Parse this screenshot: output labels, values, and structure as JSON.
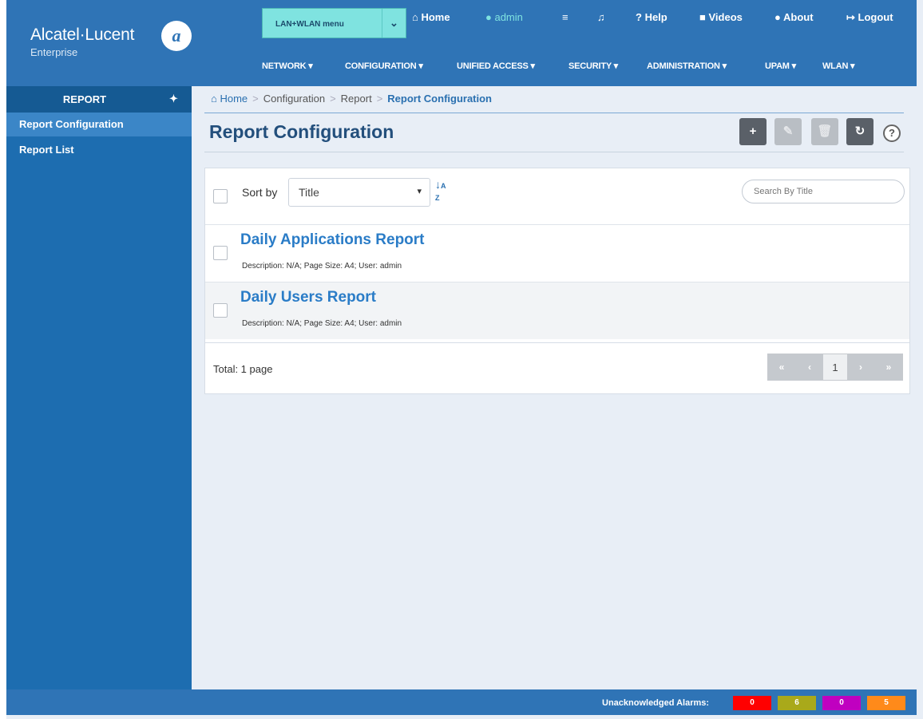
{
  "brand": {
    "name": "Alcatel·Lucent",
    "sub": "Enterprise",
    "mark": "Ð"
  },
  "header": {
    "menu_select": "LAN+WLAN menu",
    "top_links": {
      "home": "Home",
      "admin": "admin",
      "help": "Help",
      "videos": "Videos",
      "about": "About",
      "logout": "Logout"
    },
    "main_nav": [
      "NETWORK",
      "CONFIGURATION",
      "UNIFIED ACCESS",
      "SECURITY",
      "ADMINISTRATION",
      "UPAM",
      "WLAN"
    ]
  },
  "sidebar": {
    "title": "REPORT",
    "items": [
      {
        "label": "Report Configuration",
        "active": true
      },
      {
        "label": "Report List",
        "active": false
      }
    ]
  },
  "breadcrumb": {
    "home": "Home",
    "level1": "Configuration",
    "level2": "Report",
    "current": "Report Configuration"
  },
  "page": {
    "title": "Report Configuration"
  },
  "toolbar": {
    "add": "+",
    "edit": "✎",
    "delete": "🗑",
    "refresh": "↻",
    "help": "?"
  },
  "list": {
    "sort_label": "Sort by",
    "sort_value": "Title",
    "search_placeholder": "Search By Title",
    "items": [
      {
        "title": "Daily Applications Report",
        "description": "Description: N/A; Page Size: A4; User: admin"
      },
      {
        "title": "Daily Users Report",
        "description": "Description: N/A; Page Size: A4; User: admin"
      }
    ],
    "total": "Total: 1 page",
    "pagination": {
      "first": "«",
      "prev": "‹",
      "page": "1",
      "next": "›",
      "last": "»"
    }
  },
  "footer": {
    "alarms_label": "Unacknowledged Alarms:",
    "alarms": [
      {
        "value": "0",
        "color": "#ff0000"
      },
      {
        "value": "6",
        "color": "#a9a91a"
      },
      {
        "value": "0",
        "color": "#c000c0"
      },
      {
        "value": "5",
        "color": "#ff8a1a"
      }
    ]
  },
  "colors": {
    "header": "#2f74b6",
    "sidebar": "#1d6db0",
    "accent": "#2a7cc7"
  }
}
